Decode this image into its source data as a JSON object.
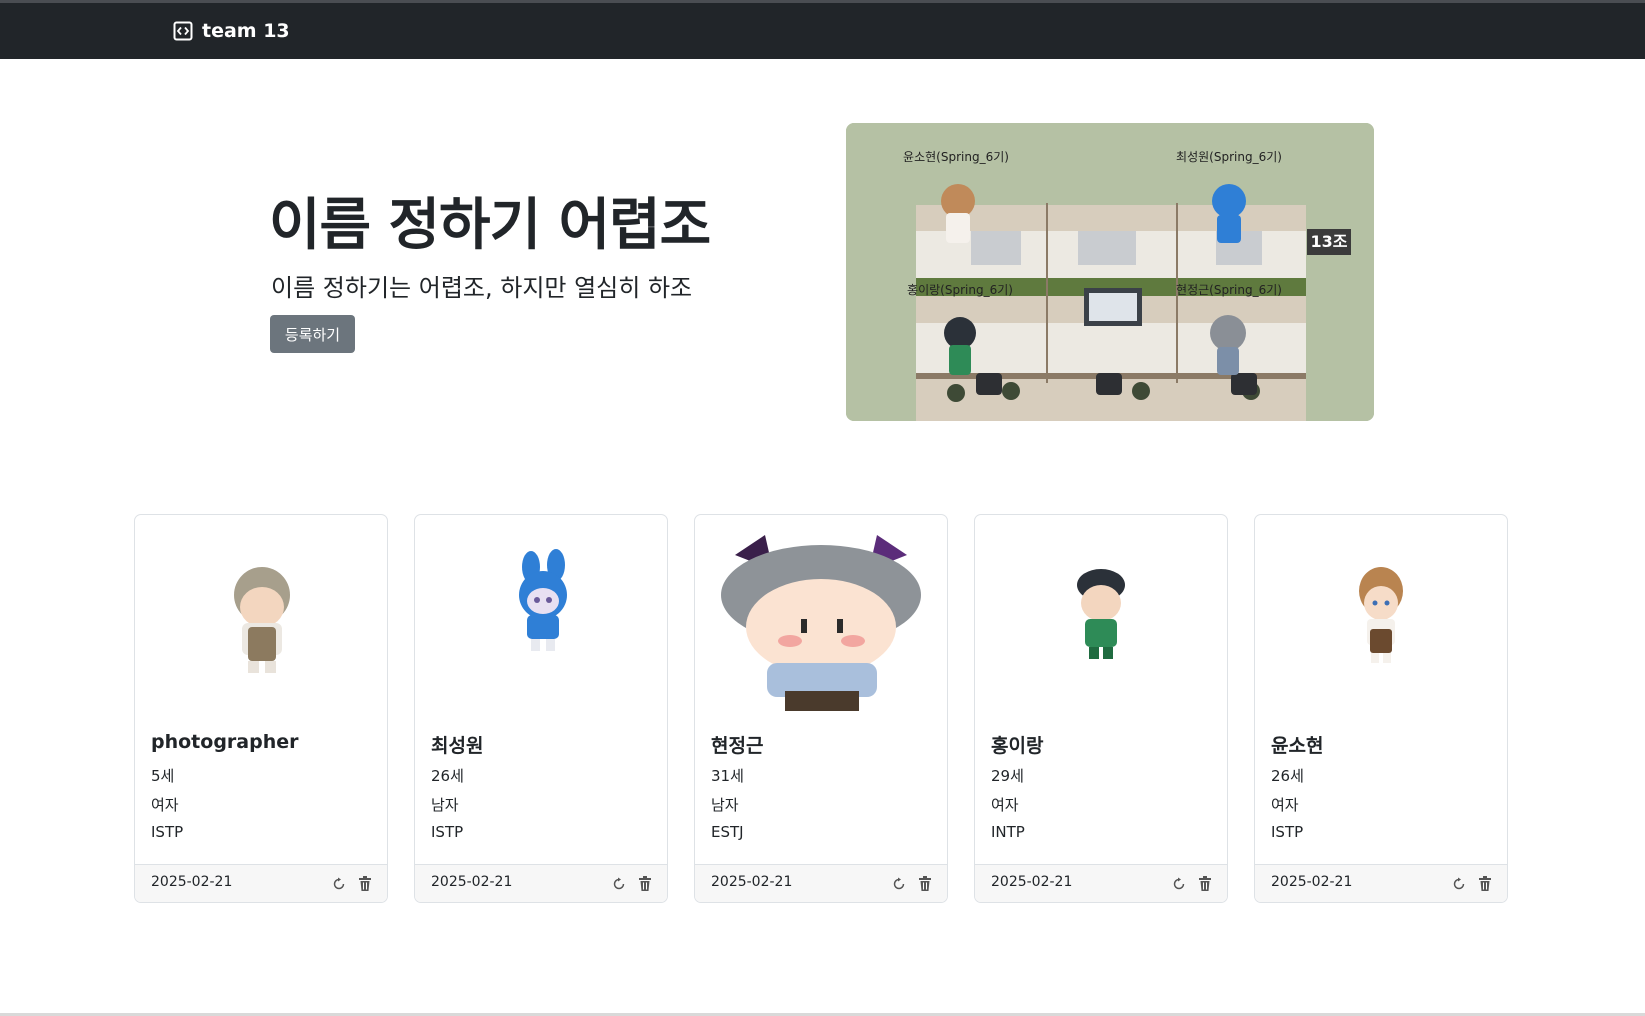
{
  "navbar": {
    "brand": "team 13"
  },
  "hero": {
    "title": "이름 정하기 어렵조",
    "subtitle": "이름 정하기는 어렵조, 하지만 열심히 하조",
    "button": "등록하기",
    "image": {
      "team_badge": "13조",
      "labels": [
        "윤소현(Spring_6기)",
        "최성원(Spring_6기)",
        "홍이랑(Spring_6기)",
        "현정근(Spring_6기)"
      ]
    }
  },
  "members": [
    {
      "name": "photographer",
      "age": "5세",
      "gender": "여자",
      "mbti": "ISTP",
      "date": "2025-02-21"
    },
    {
      "name": "최성원",
      "age": "26세",
      "gender": "남자",
      "mbti": "ISTP",
      "date": "2025-02-21"
    },
    {
      "name": "현정근",
      "age": "31세",
      "gender": "남자",
      "mbti": "ESTJ",
      "date": "2025-02-21"
    },
    {
      "name": "홍이랑",
      "age": "29세",
      "gender": "여자",
      "mbti": "INTP",
      "date": "2025-02-21"
    },
    {
      "name": "윤소현",
      "age": "26세",
      "gender": "여자",
      "mbti": "ISTP",
      "date": "2025-02-21"
    }
  ],
  "icons": {
    "brand": "code-brackets-icon",
    "refresh": "refresh-icon",
    "delete": "trash-icon"
  },
  "colors": {
    "navbar": "#212529",
    "button": "#6c757d",
    "hero_image_bg": "#b5c1a4"
  }
}
